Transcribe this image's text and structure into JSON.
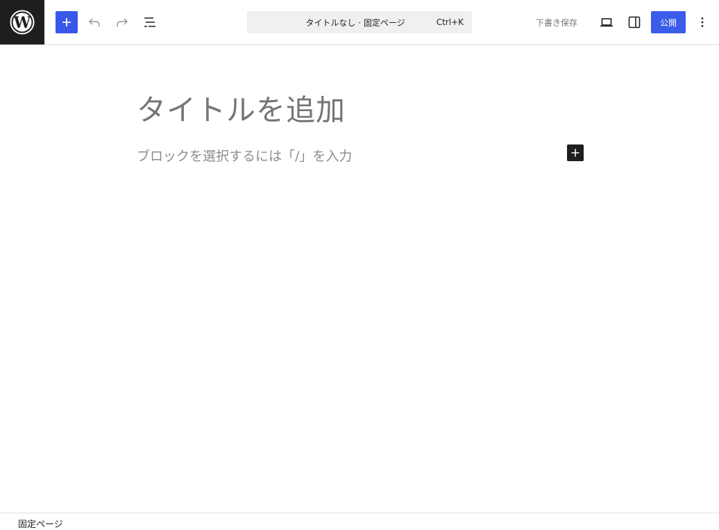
{
  "header": {
    "command_title": "タイトルなし · 固定ページ",
    "command_shortcut": "Ctrl+K",
    "save_draft_label": "下書き保存",
    "publish_label": "公開"
  },
  "editor": {
    "title_placeholder": "タイトルを追加",
    "block_placeholder": "ブロックを選択するには「/」を入力"
  },
  "footer": {
    "breadcrumb": "固定ページ"
  },
  "colors": {
    "accent": "#3858e9",
    "dark": "#1e1e1e",
    "muted": "#757575"
  },
  "icons": {
    "logo": "wordpress-logo-icon",
    "inserter": "plus-icon",
    "undo": "undo-icon",
    "redo": "redo-icon",
    "list_view": "list-view-icon",
    "preview": "desktop-icon",
    "settings": "sidebar-toggle-icon",
    "options": "more-vertical-icon"
  }
}
